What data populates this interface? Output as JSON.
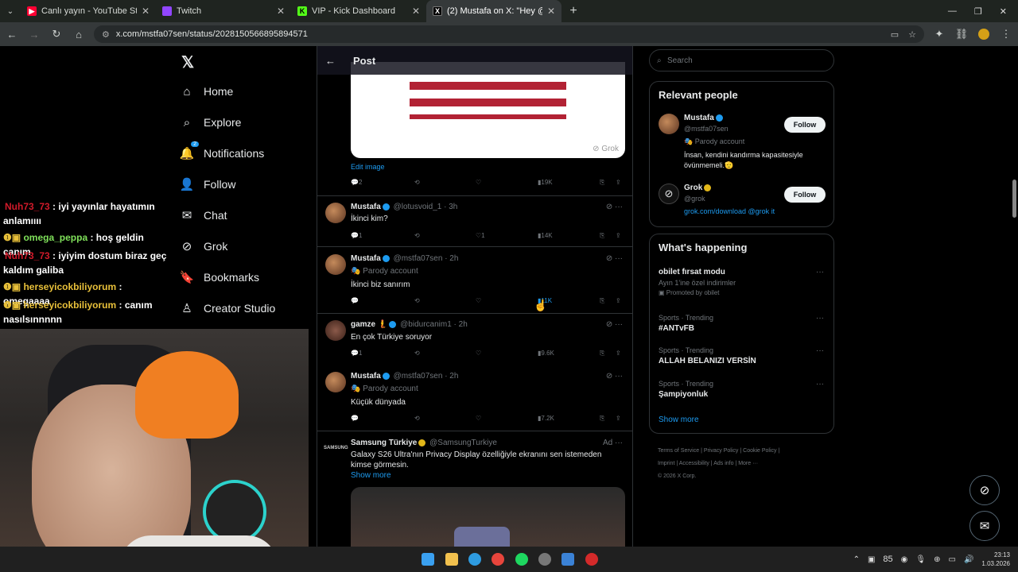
{
  "browser": {
    "tabs": [
      {
        "title": "Canlı yayın - YouTube Studio",
        "color": "#ff0033",
        "icon": "youtube-icon"
      },
      {
        "title": "Twitch",
        "color": "#9146ff",
        "icon": "twitch-icon"
      },
      {
        "title": "VIP - Kick Dashboard",
        "color": "#53fc18",
        "icon": "kick-icon"
      },
      {
        "title": "(2) Mustafa on X: \"Hey @grok s",
        "color": "#ffffff",
        "icon": "x-icon"
      }
    ],
    "url": "x.com/mstfa07sen/status/2028150566895894571"
  },
  "chat": [
    {
      "user": "Nuh73_73",
      "color": "#d11a2a",
      "text": " : iyi yayınlar hayatımın anlamıııı"
    },
    {
      "user": "omega_peppa",
      "color": "#7fe05a",
      "text": " : hoş geldin canım"
    },
    {
      "user": "Nuh73_73",
      "color": "#d11a2a",
      "text": " : iyiyim dostum biraz geç kaldım galiba"
    },
    {
      "user": "herseyicokbiliyorum",
      "color": "#e8c03a",
      "text": " : omegaaaa"
    },
    {
      "user": "herseyicokbiliyorum",
      "color": "#e8c03a",
      "text": " : canım nasılsınnnnn"
    }
  ],
  "nav": [
    {
      "label": "Home",
      "icon": "home-icon"
    },
    {
      "label": "Explore",
      "icon": "search-icon"
    },
    {
      "label": "Notifications",
      "icon": "bell-icon",
      "badge": "2"
    },
    {
      "label": "Follow",
      "icon": "person-plus-icon"
    },
    {
      "label": "Chat",
      "icon": "mail-icon"
    },
    {
      "label": "Grok",
      "icon": "grok-icon"
    },
    {
      "label": "Bookmarks",
      "icon": "bookmark-icon"
    },
    {
      "label": "Creator Studio",
      "icon": "creator-icon"
    }
  ],
  "feed": {
    "title": "Post",
    "image_label": "Grok",
    "edit_image": "Edit image",
    "main_stats": {
      "replies": "2",
      "views": "19K"
    },
    "posts": [
      {
        "name": "Mustafa",
        "handle": "@lotusvoid_1 · 3h",
        "parody": "",
        "text": "İkinci kim?",
        "replies": "1",
        "likes": "1",
        "views": "14K"
      },
      {
        "name": "Mustafa",
        "handle": "@mstfa07sen · 2h",
        "parody": "Parody account",
        "text": "İkinci biz sanırım",
        "replies": "",
        "likes": "",
        "views": "11K"
      },
      {
        "name": "gamze",
        "handle": "@bidurcanim1 · 2h",
        "parody": "",
        "text": "En çok Türkiye soruyor",
        "replies": "1",
        "likes": "",
        "views": "9.6K"
      },
      {
        "name": "Mustafa",
        "handle": "@mstfa07sen · 2h",
        "parody": "Parody account",
        "text": "Küçük dünyada",
        "replies": "",
        "likes": "",
        "views": "7.2K"
      }
    ],
    "ad": {
      "name": "Samsung Türkiye",
      "handle": "@SamsungTurkiye",
      "tag": "Ad",
      "text": "Galaxy S26 Ultra'nın Privacy Display özelliğiyle ekranını sen istemeden kimse görmesin.",
      "more": "Show more",
      "logo": "SAMSUNG"
    }
  },
  "right": {
    "search": "Search",
    "relevant_title": "Relevant people",
    "people": [
      {
        "name": "Mustafa",
        "handle": "@mstfa07sen",
        "parody": "Parody account",
        "bio": "İnsan, kendini kandırma kapasitesiyle övünmemeli.🫡",
        "follow": "Follow"
      },
      {
        "name": "Grok",
        "handle": "@grok",
        "bio": "grok.com/download @grok it",
        "follow": "Follow"
      }
    ],
    "happening_title": "What's happening",
    "trends": [
      {
        "meta": "",
        "title": "obilet fırsat modu",
        "sub": "Ayın 1'ine özel indirimler",
        "promo": "Promoted by obilet"
      },
      {
        "meta": "Sports · Trending",
        "title": "#ANTvFB"
      },
      {
        "meta": "Sports · Trending",
        "title": "ALLAH BELANIZI VERSİN"
      },
      {
        "meta": "Sports · Trending",
        "title": "Şampiyonluk"
      }
    ],
    "show_more": "Show more",
    "footer": [
      "Terms of Service",
      "Privacy Policy",
      "Cookie Policy",
      "Imprint",
      "Accessibility",
      "Ads info",
      "More ···",
      "© 2026 X Corp."
    ]
  },
  "taskbar": {
    "temp": "85",
    "time": "23:13",
    "date": "1.03.2026"
  }
}
